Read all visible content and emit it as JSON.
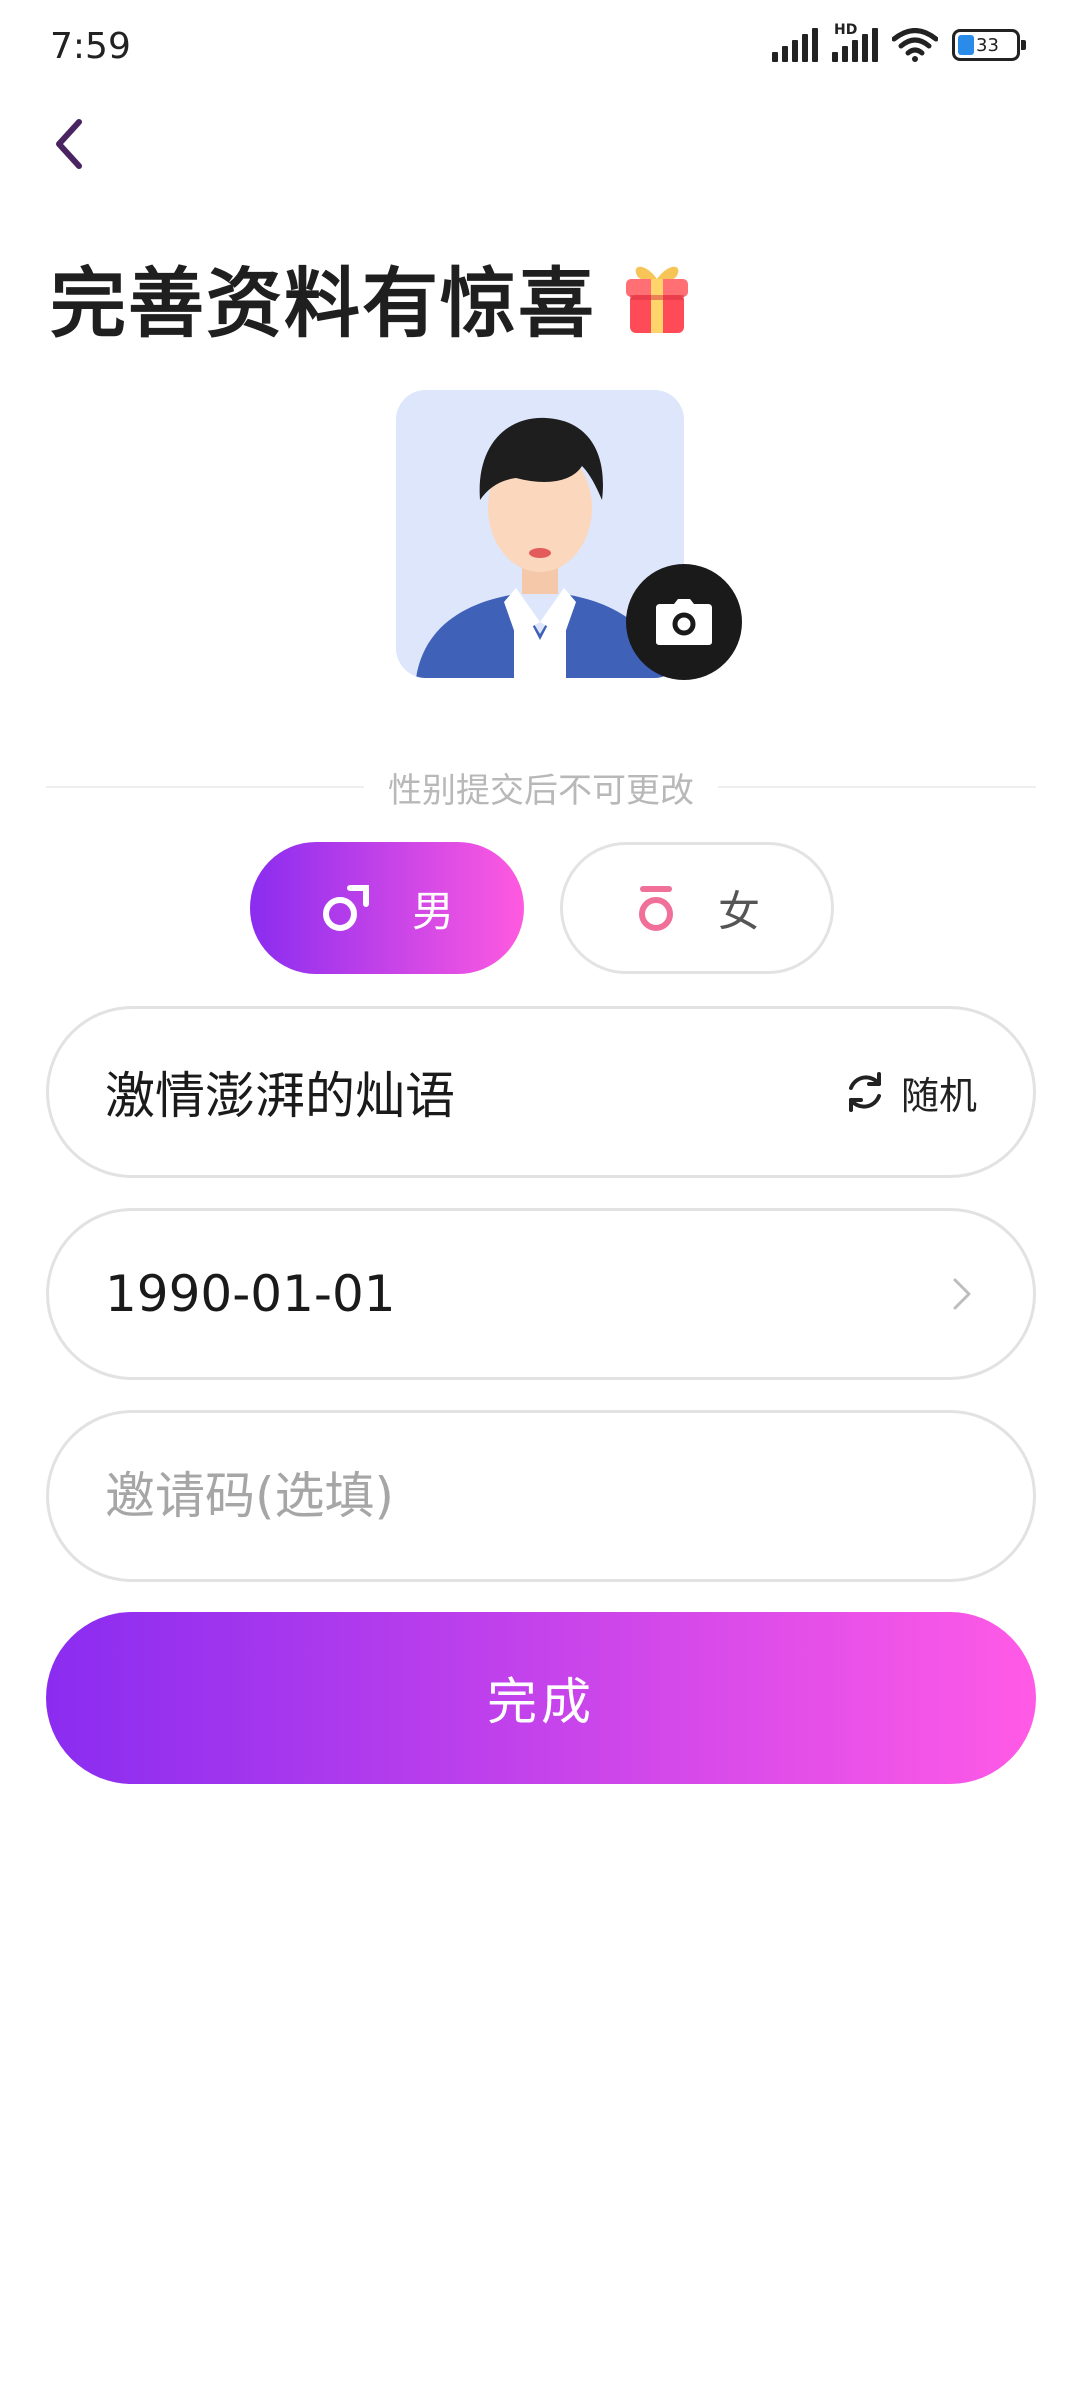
{
  "status_bar": {
    "time": "7:59",
    "hd_label": "HD",
    "battery_level": "33",
    "icons": [
      "signal-icon",
      "signal-hd-icon",
      "wifi-icon",
      "battery-icon"
    ]
  },
  "header": {
    "back_icon": "chevron-left-icon",
    "title": "完善资料有惊喜",
    "title_icon": "gift-icon"
  },
  "avatar": {
    "icon": "male-avatar-illustration",
    "camera_icon": "camera-icon"
  },
  "gender": {
    "hint": "性别提交后不可更改",
    "male_label": "男",
    "female_label": "女",
    "selected": "male",
    "male_icon": "male-symbol-icon",
    "female_icon": "female-symbol-icon"
  },
  "form": {
    "nickname": "激情澎湃的灿语",
    "random_label": "随机",
    "random_icon": "refresh-icon",
    "birthday": "1990-01-01",
    "birthday_icon": "chevron-right-icon",
    "invite_placeholder": "邀请码(选填)"
  },
  "actions": {
    "finish_label": "完成"
  },
  "colors": {
    "gradient_start": "#8a2cf0",
    "gradient_end": "#ff5ae6",
    "back_icon": "#4a2460",
    "female_icon": "#f0709a"
  }
}
